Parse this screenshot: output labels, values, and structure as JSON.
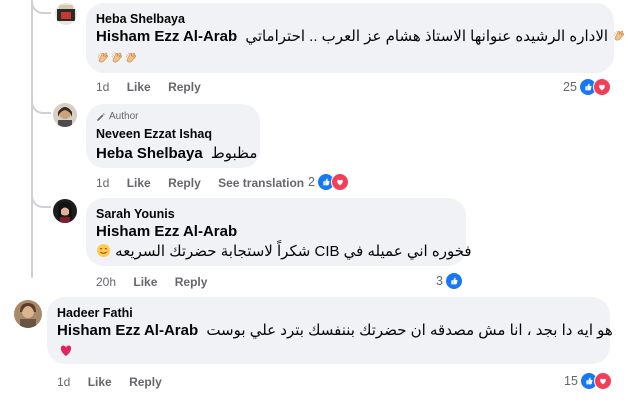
{
  "comments": [
    {
      "author": "Heba Shelbaya",
      "mention": "Hisham Ezz Al-Arab",
      "text_line1": "الاداره الرشيده عنوانها الاستاذ هشام عز العرب .. احتراماتي",
      "time": "1d",
      "like_label": "Like",
      "reply_label": "Reply",
      "reaction_count": "25"
    },
    {
      "badge": "Author",
      "author": "Neveen Ezzat Ishaq",
      "mention": "Heba Shelbaya",
      "text_line1": "مظبوط",
      "time": "1d",
      "like_label": "Like",
      "reply_label": "Reply",
      "translate_label": "See translation",
      "reaction_count": "2"
    },
    {
      "author": "Sarah Younis",
      "mention": "Hisham Ezz Al-Arab",
      "text_line1": "فخوره اني عميله في CIB شكراً لاستجابة حضرتك السريعه",
      "time": "20h",
      "like_label": "Like",
      "reply_label": "Reply",
      "reaction_count": "3"
    },
    {
      "author": "Hadeer Fathi",
      "mention": "Hisham Ezz Al-Arab",
      "text_line1": "هو ايه دا بجد ، انا مش مصدقه ان حضرتك بننفسك بترد علي بوست",
      "time": "1d",
      "like_label": "Like",
      "reply_label": "Reply",
      "reaction_count": "15"
    }
  ],
  "colors": {
    "bubble": "#f0f2f5",
    "like_blue": "#1877f2",
    "love_red": "#f33e58",
    "meta_gray": "#65676b"
  }
}
